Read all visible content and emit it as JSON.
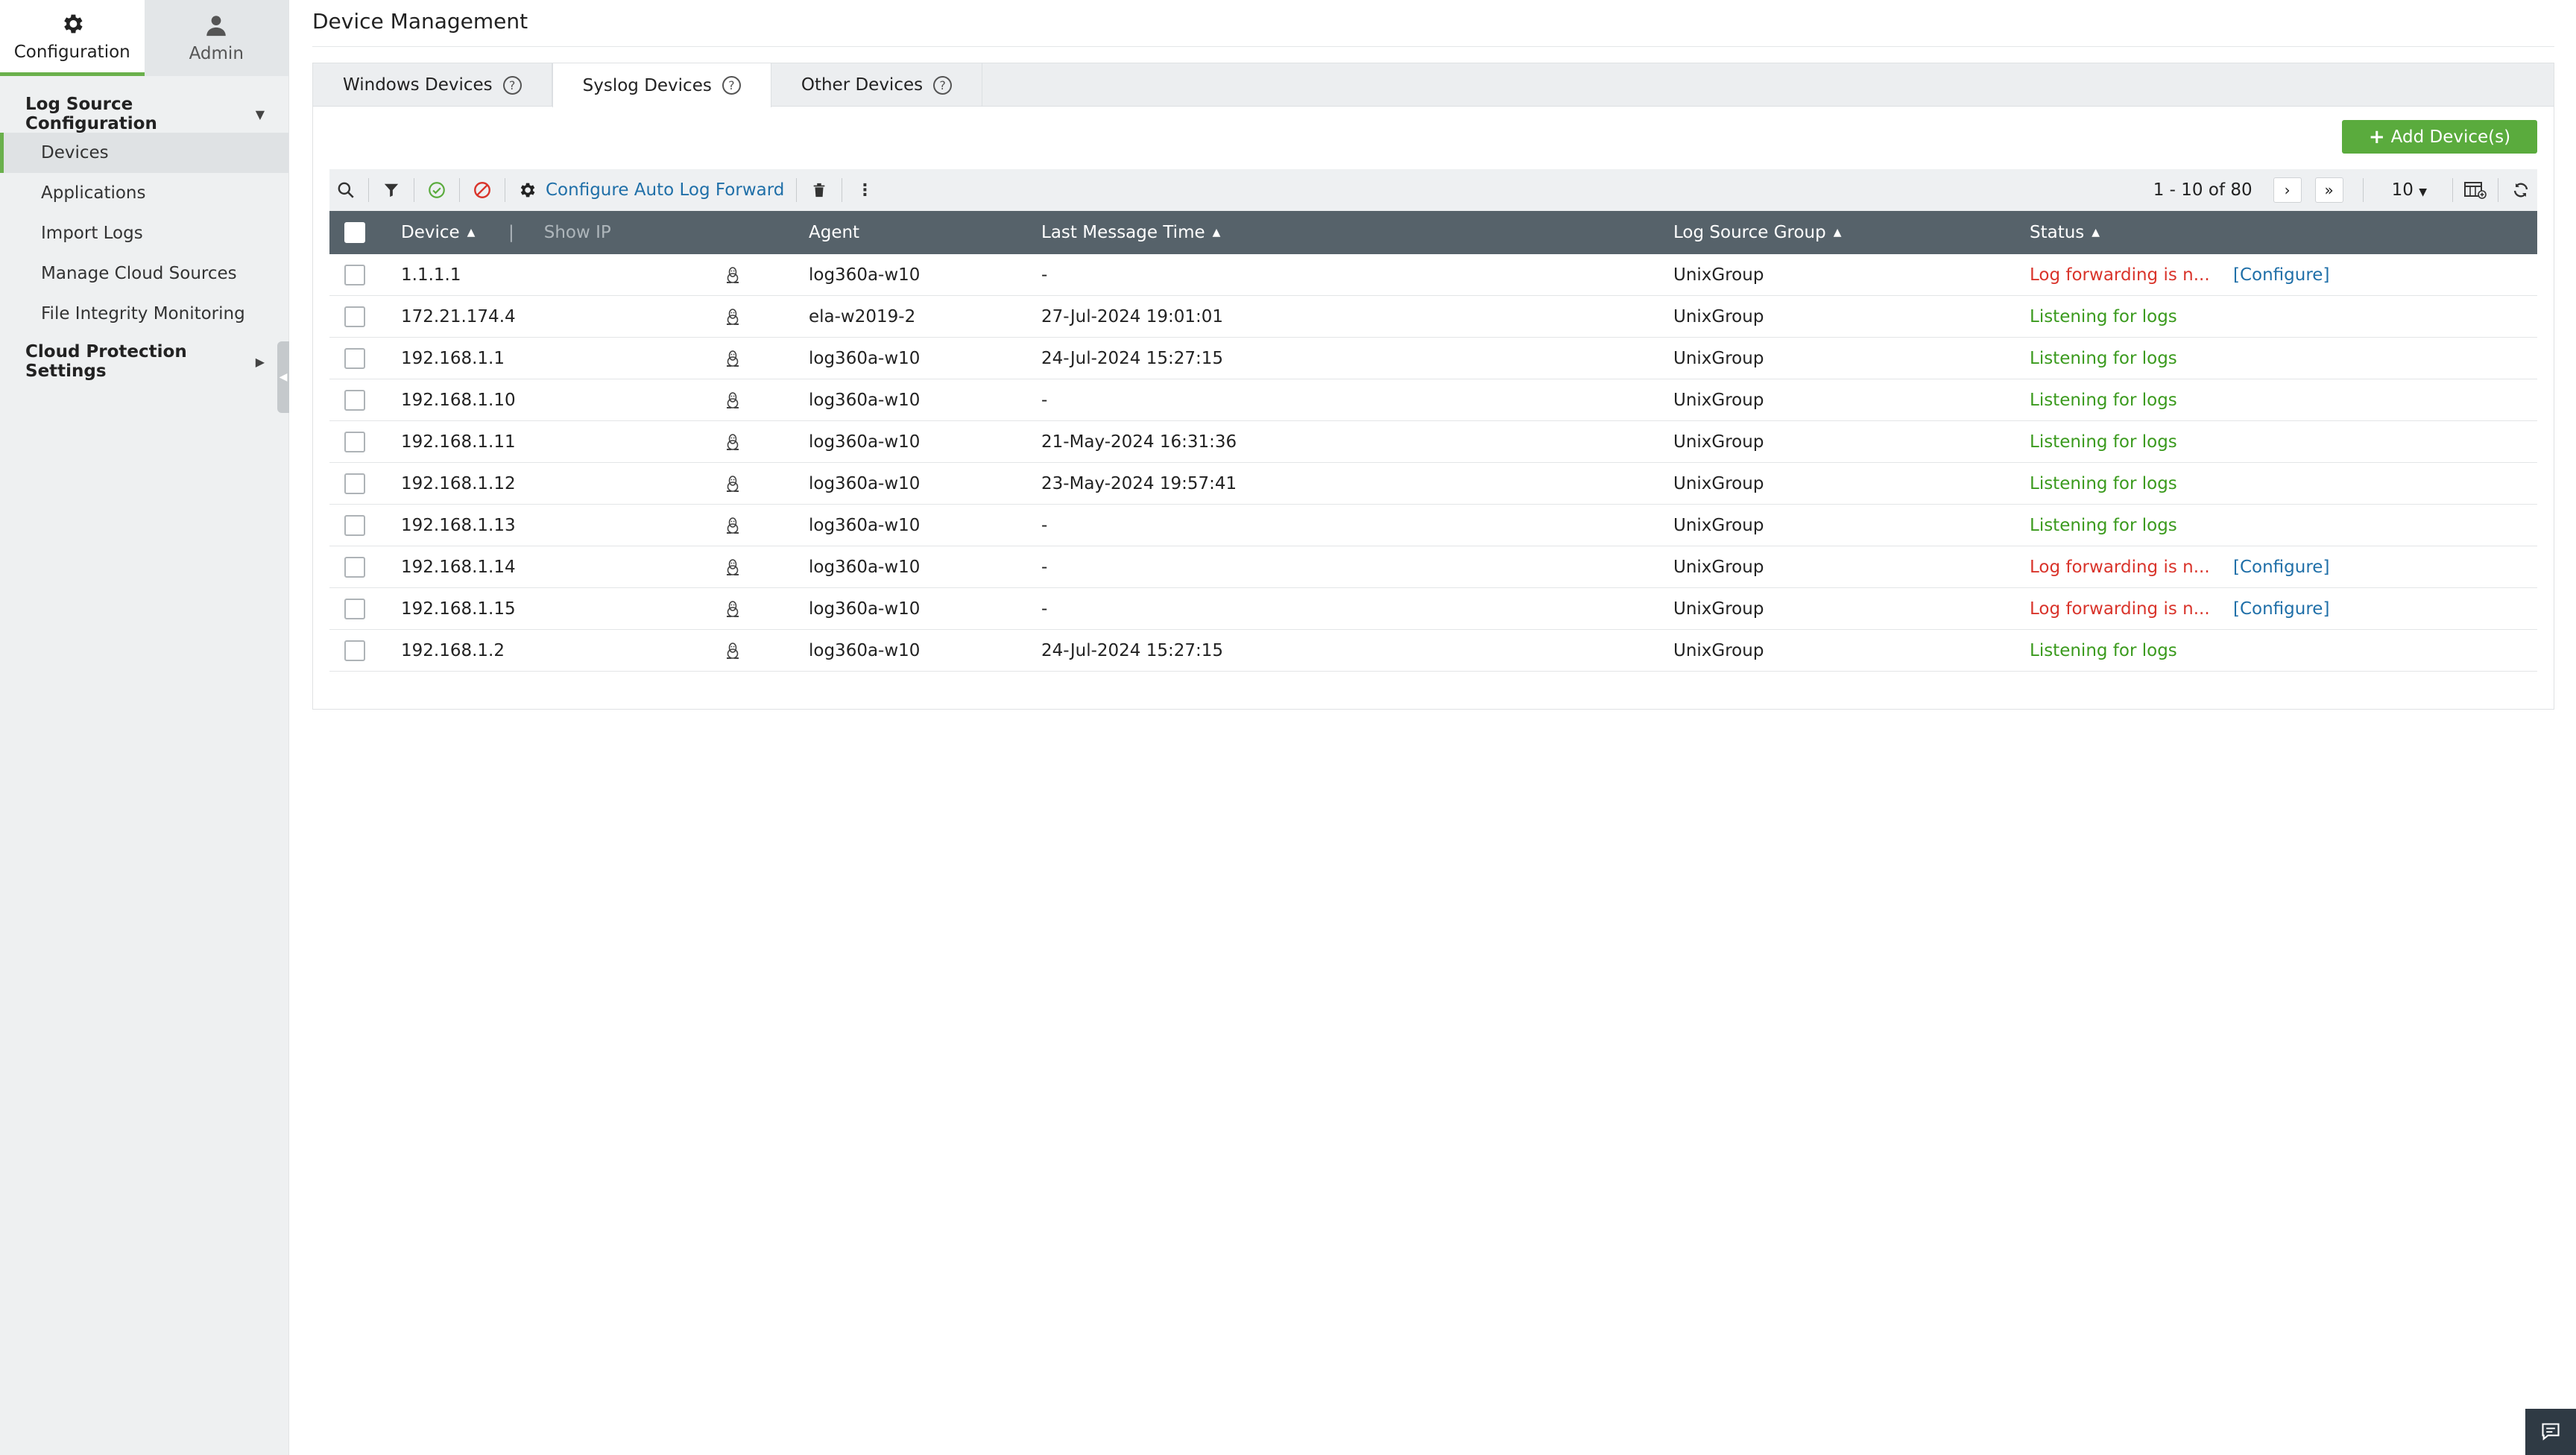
{
  "sidebar": {
    "top_tabs": [
      {
        "label": "Configuration",
        "icon": "gear-icon",
        "active": true
      },
      {
        "label": "Admin",
        "icon": "user-icon",
        "active": false
      }
    ],
    "section_log_source": "Log Source Configuration",
    "items": [
      {
        "label": "Devices",
        "active": true
      },
      {
        "label": "Applications"
      },
      {
        "label": "Import Logs"
      },
      {
        "label": "Manage Cloud Sources"
      },
      {
        "label": "File Integrity Monitoring"
      }
    ],
    "section_cloud": "Cloud Protection Settings"
  },
  "main": {
    "title": "Device Management",
    "tabs": [
      {
        "label": "Windows Devices",
        "active": false
      },
      {
        "label": "Syslog Devices",
        "active": true
      },
      {
        "label": "Other Devices",
        "active": false
      }
    ],
    "help_glyph": "?",
    "add_button": "Add Device(s)",
    "toolbar": {
      "auto_forward": "Configure Auto Log Forward"
    },
    "pager": {
      "range": "1 - 10 of 80",
      "page_size": "10"
    }
  },
  "table": {
    "headers": {
      "device": "Device",
      "show_ip": "Show IP",
      "agent": "Agent",
      "last_message": "Last Message Time",
      "group": "Log Source Group",
      "status": "Status"
    },
    "configure_label": "[Configure]",
    "rows": [
      {
        "device": "1.1.1.1",
        "agent": "log360a-w10",
        "time": "-",
        "group": "UnixGroup",
        "status": "Log forwarding is n...",
        "ok": false
      },
      {
        "device": "172.21.174.4",
        "agent": "ela-w2019-2",
        "time": "27-Jul-2024 19:01:01",
        "group": "UnixGroup",
        "status": "Listening for logs",
        "ok": true
      },
      {
        "device": "192.168.1.1",
        "agent": "log360a-w10",
        "time": "24-Jul-2024 15:27:15",
        "group": "UnixGroup",
        "status": "Listening for logs",
        "ok": true
      },
      {
        "device": "192.168.1.10",
        "agent": "log360a-w10",
        "time": "-",
        "group": "UnixGroup",
        "status": "Listening for logs",
        "ok": true
      },
      {
        "device": "192.168.1.11",
        "agent": "log360a-w10",
        "time": "21-May-2024 16:31:36",
        "group": "UnixGroup",
        "status": "Listening for logs",
        "ok": true
      },
      {
        "device": "192.168.1.12",
        "agent": "log360a-w10",
        "time": "23-May-2024 19:57:41",
        "group": "UnixGroup",
        "status": "Listening for logs",
        "ok": true
      },
      {
        "device": "192.168.1.13",
        "agent": "log360a-w10",
        "time": "-",
        "group": "UnixGroup",
        "status": "Listening for logs",
        "ok": true
      },
      {
        "device": "192.168.1.14",
        "agent": "log360a-w10",
        "time": "-",
        "group": "UnixGroup",
        "status": "Log forwarding is n...",
        "ok": false
      },
      {
        "device": "192.168.1.15",
        "agent": "log360a-w10",
        "time": "-",
        "group": "UnixGroup",
        "status": "Log forwarding is n...",
        "ok": false
      },
      {
        "device": "192.168.1.2",
        "agent": "log360a-w10",
        "time": "24-Jul-2024 15:27:15",
        "group": "UnixGroup",
        "status": "Listening for logs",
        "ok": true
      }
    ]
  },
  "colors": {
    "accent_green": "#6ab04c",
    "button_green": "#5aab3d",
    "header_dark": "#56626a",
    "link_blue": "#1f6fa8",
    "status_ok": "#3a9a1d",
    "status_error": "#d9342b"
  }
}
